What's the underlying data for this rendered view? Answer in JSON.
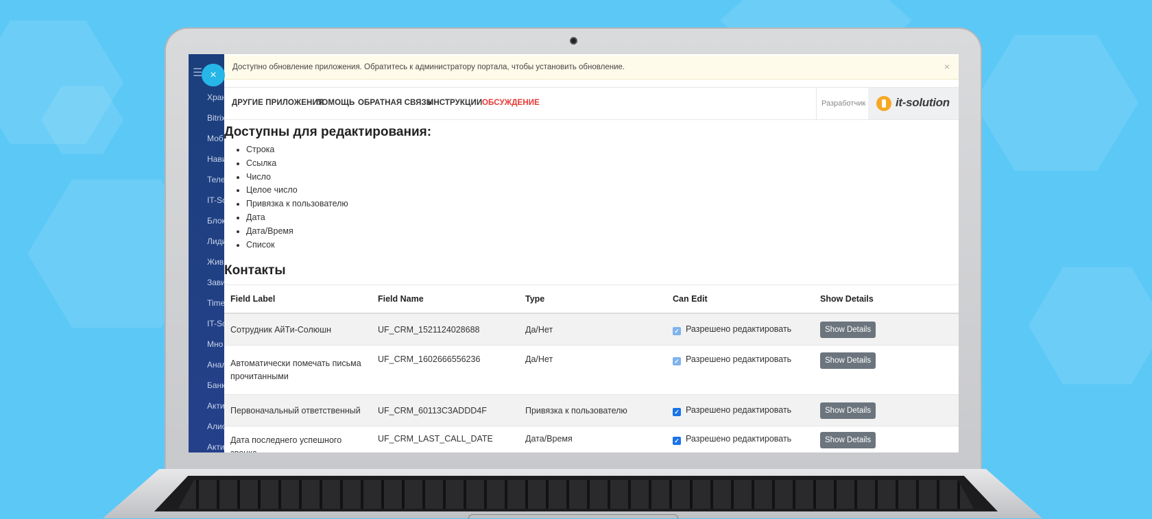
{
  "notice": {
    "text": "Доступно обновление приложения. Обратитесь к администратору портала, чтобы установить обновление.",
    "close": "×"
  },
  "close_button": "×",
  "sidebar": {
    "items": [
      "Хран",
      "Bitrix",
      "Моб",
      "Нави",
      "Теле",
      "IT-Sc",
      "Блок",
      "Лиди",
      "Жив",
      "Зави",
      "Time",
      "IT-Sc",
      "Мно",
      "Анал",
      "Банк",
      "Акти",
      "Алис",
      "Акти"
    ]
  },
  "nav": {
    "links": [
      "ДРУГИЕ ПРИЛОЖЕНИЯ",
      "ПОМОЩЬ",
      "ОБРАТНАЯ СВЯЗЬ",
      "ИНСТРУКЦИИ",
      "ОБСУЖДЕНИЕ"
    ],
    "developer": "Разработчик",
    "logo": "it-solution"
  },
  "editable": {
    "heading": "Доступны для редактирования:",
    "types": [
      "Строка",
      "Ссылка",
      "Число",
      "Целое число",
      "Привязка к пользователю",
      "Дата",
      "Дата/Время",
      "Список"
    ]
  },
  "contacts": {
    "heading": "Контакты",
    "columns": [
      "Field Label",
      "Field Name",
      "Type",
      "Can Edit",
      "Show Details"
    ],
    "rows": [
      {
        "label": "Сотрудник АйТи-Солюшн",
        "name": "UF_CRM_1521124028688",
        "type": "Да/Нет",
        "can_edit": "Разрешено редактировать",
        "button": "Show Details"
      },
      {
        "label": "Автоматически помечать письма прочитанными",
        "name": "UF_CRM_1602666556236",
        "type": "Да/Нет",
        "can_edit": "Разрешено редактировать",
        "button": "Show Details"
      },
      {
        "label": "Первоначальный ответственный",
        "name": "UF_CRM_60113C3ADDD4F",
        "type": "Привязка к пользователю",
        "can_edit": "Разрешено редактировать",
        "button": "Show Details"
      },
      {
        "label": "Дата последнего успешного звонка",
        "name": "UF_CRM_LAST_CALL_DATE",
        "type": "Дата/Время",
        "can_edit": "Разрешено редактировать",
        "button": "Show Details"
      }
    ]
  },
  "colors": {
    "background": "#5cc8f6",
    "sidebar": "#1b3f7c",
    "accent_red": "#e53935",
    "checkbox": "#1a73e8",
    "button": "#6c757d"
  }
}
